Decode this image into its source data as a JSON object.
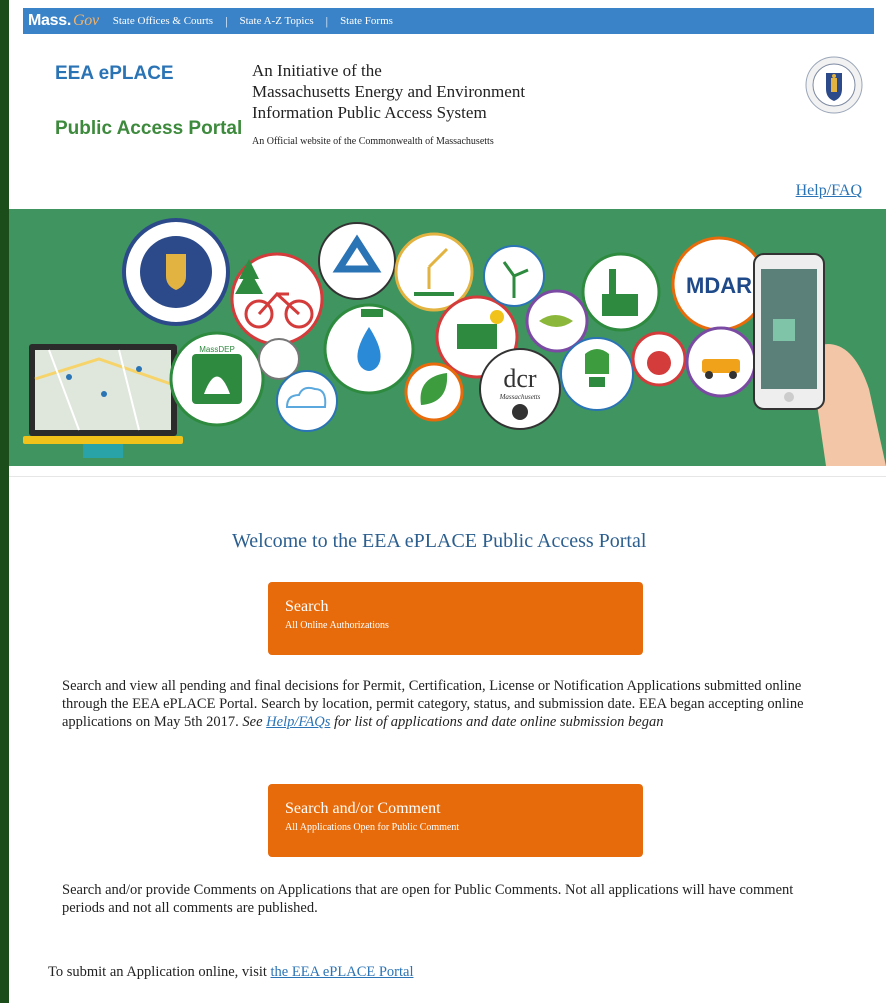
{
  "topbar": {
    "logo_text": "Mass.",
    "logo_gov": "Gov",
    "nav": [
      "State Offices & Courts",
      "State A-Z Topics",
      "State Forms"
    ],
    "separator": "|"
  },
  "header": {
    "brand_title": "EEA ePLACE",
    "brand_subtitle": "Public Access Portal",
    "initiative_lines": [
      "An Initiative of the",
      "Massachusetts Energy and Environment",
      "Information Public Access System"
    ],
    "official_text": "An Official website of the Commonwealth of Massachusetts",
    "help_link": "Help/FAQ"
  },
  "banner": {
    "badges": [
      "MassDEP",
      "MDAR",
      "dcr",
      "Massachusetts"
    ]
  },
  "main": {
    "welcome": "Welcome to the EEA ePLACE Public Access Portal",
    "search_button": {
      "title": "Search",
      "subtitle": "All Online Authorizations"
    },
    "search_description": "Search and view all pending and final decisions for Permit, Certification, License or Notification Applications submitted online through the EEA ePLACE Portal. Search by location, permit category, status, and submission date. EEA began accepting online applications on May 5th 2017.",
    "search_note_prefix": "See",
    "search_note_link": "Help/FAQs",
    "search_note_suffix": "for list of applications and date online submission began",
    "comment_button": {
      "title": "Search and/or Comment",
      "subtitle": "All Applications Open for Public Comment"
    },
    "comment_description": "Search and/or provide Comments on Applications that are open for Public Comments. Not all applications will have comment periods and not all comments are published.",
    "submit_prefix": "To submit an Application online, visit",
    "submit_link": "the EEA ePLACE Portal"
  },
  "colors": {
    "topbar": "#3a83c9",
    "brand_blue": "#2a73b5",
    "brand_green": "#3d8a3d",
    "banner_green": "#3f9460",
    "button_orange": "#e76b0b",
    "left_rail": "#1b4d1b"
  }
}
